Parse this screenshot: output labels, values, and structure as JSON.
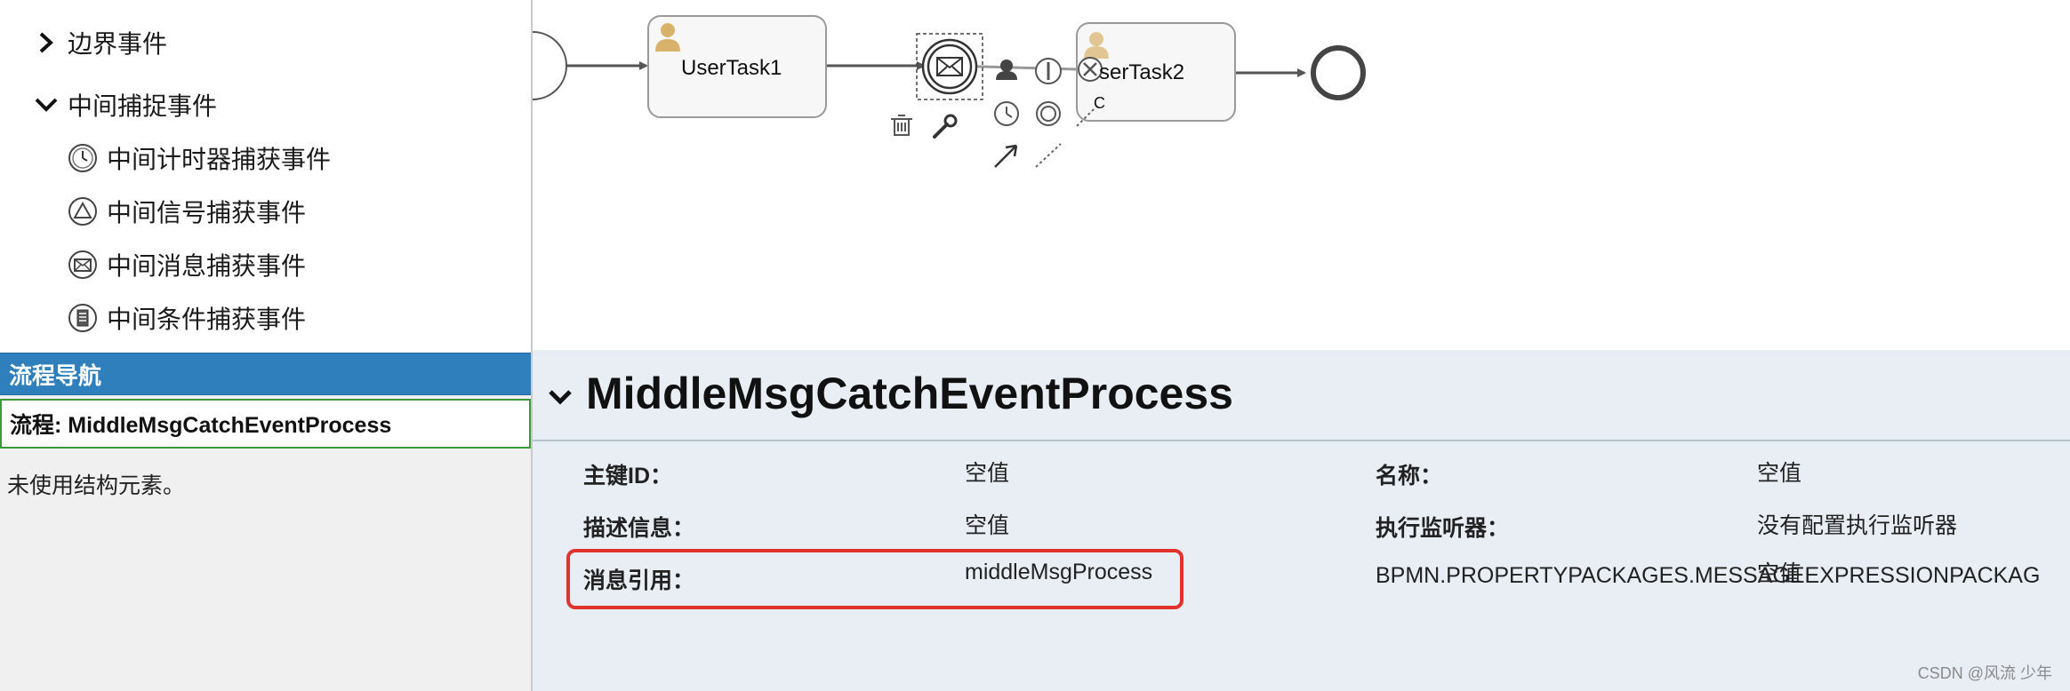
{
  "palette": {
    "boundary_group": "边界事件",
    "intermediate_group": "中间捕捉事件",
    "items": [
      {
        "label": "中间计时器捕获事件",
        "icon": "timer-icon"
      },
      {
        "label": "中间信号捕获事件",
        "icon": "signal-icon"
      },
      {
        "label": "中间消息捕获事件",
        "icon": "message-icon"
      },
      {
        "label": "中间条件捕获事件",
        "icon": "condition-icon"
      }
    ]
  },
  "navigation": {
    "header": "流程导航",
    "process": "流程: MiddleMsgCatchEventProcess",
    "empty": "未使用结构元素。"
  },
  "diagram": {
    "task1": "UserTask1",
    "task2": "serTask2",
    "task2_fragment": "C"
  },
  "properties": {
    "title": "MiddleMsgCatchEventProcess",
    "rows": [
      {
        "key": "主键ID：",
        "value": "空值"
      },
      {
        "key": "名称：",
        "value": "空值"
      },
      {
        "key": "描述信息：",
        "value": "空值"
      },
      {
        "key": "执行监听器：",
        "value": "没有配置执行监听器"
      },
      {
        "key": "消息引用：",
        "value": "middleMsgProcess"
      },
      {
        "key": "BPMN.PROPERTYPACKAGES.MESSAGEEXPRESSIONPACKAG",
        "value": "空值"
      }
    ]
  },
  "watermark": "CSDN @风流 少年",
  "colors": {
    "nav_header": "#2f7fbd",
    "highlight": "#e3312d",
    "props_bg": "#e8eef4",
    "user_icon": "#d8b26a"
  }
}
